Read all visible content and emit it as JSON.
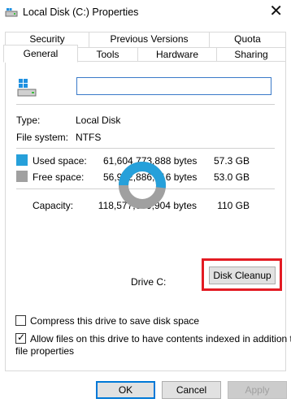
{
  "window": {
    "title": "Local Disk (C:) Properties",
    "close_glyph": "✕"
  },
  "tabs_row_back": [
    "Security",
    "Previous Versions",
    "Quota"
  ],
  "tabs_row_front": [
    "General",
    "Tools",
    "Hardware",
    "Sharing"
  ],
  "active_tab": "General",
  "drive": {
    "name_value": ""
  },
  "info": {
    "type_label": "Type:",
    "type_value": "Local Disk",
    "fs_label": "File system:",
    "fs_value": "NTFS"
  },
  "space": {
    "used_label": "Used space:",
    "used_bytes": "61,604,773,888 bytes",
    "used_gb": "57.3 GB",
    "free_label": "Free space:",
    "free_bytes": "56,972,886,016 bytes",
    "free_gb": "53.0 GB",
    "capacity_label": "Capacity:",
    "capacity_bytes": "118,577,659,904 bytes",
    "capacity_gb": "110 GB",
    "used_color": "#26a0da",
    "free_color": "#a0a0a0",
    "used_fraction": 0.5195
  },
  "drive_label": "Drive C:",
  "disk_cleanup_label": "Disk Cleanup",
  "options": {
    "compress_label": "Compress this drive to save disk space",
    "compress_checked": false,
    "index_label_line1": "Allow files on this drive to have contents indexed in addition to",
    "index_label_line2": "file properties",
    "index_checked": true
  },
  "buttons": {
    "ok": "OK",
    "cancel": "Cancel",
    "apply": "Apply"
  },
  "highlight_color": "#e31b23"
}
